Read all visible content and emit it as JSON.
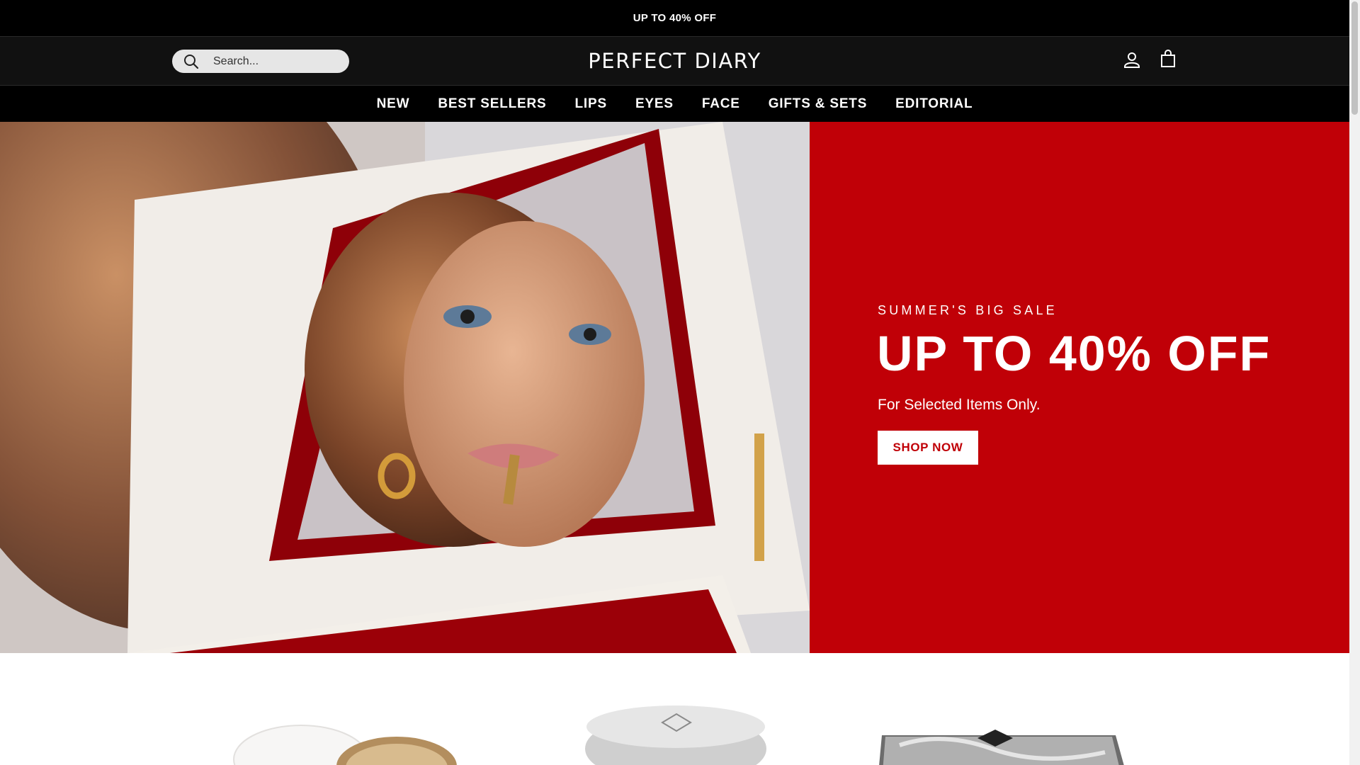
{
  "announcement": {
    "text": "UP TO 40% OFF"
  },
  "header": {
    "search_placeholder": "Search...",
    "logo": "PERFECT DIARY",
    "icons": [
      "account-icon",
      "cart-icon"
    ]
  },
  "nav": {
    "items": [
      "NEW",
      "BEST SELLERS",
      "LIPS",
      "EYES",
      "FACE",
      "GIFTS & SETS",
      "EDITORIAL"
    ]
  },
  "hero": {
    "eyebrow": "SUMMER'S BIG SALE",
    "headline": "UP TO 40% OFF",
    "subtext": "For Selected Items Only.",
    "cta": "SHOP NOW"
  },
  "colors": {
    "brand_red": "#c00007",
    "header_bg": "#111111",
    "announcement_bg": "#000000"
  }
}
